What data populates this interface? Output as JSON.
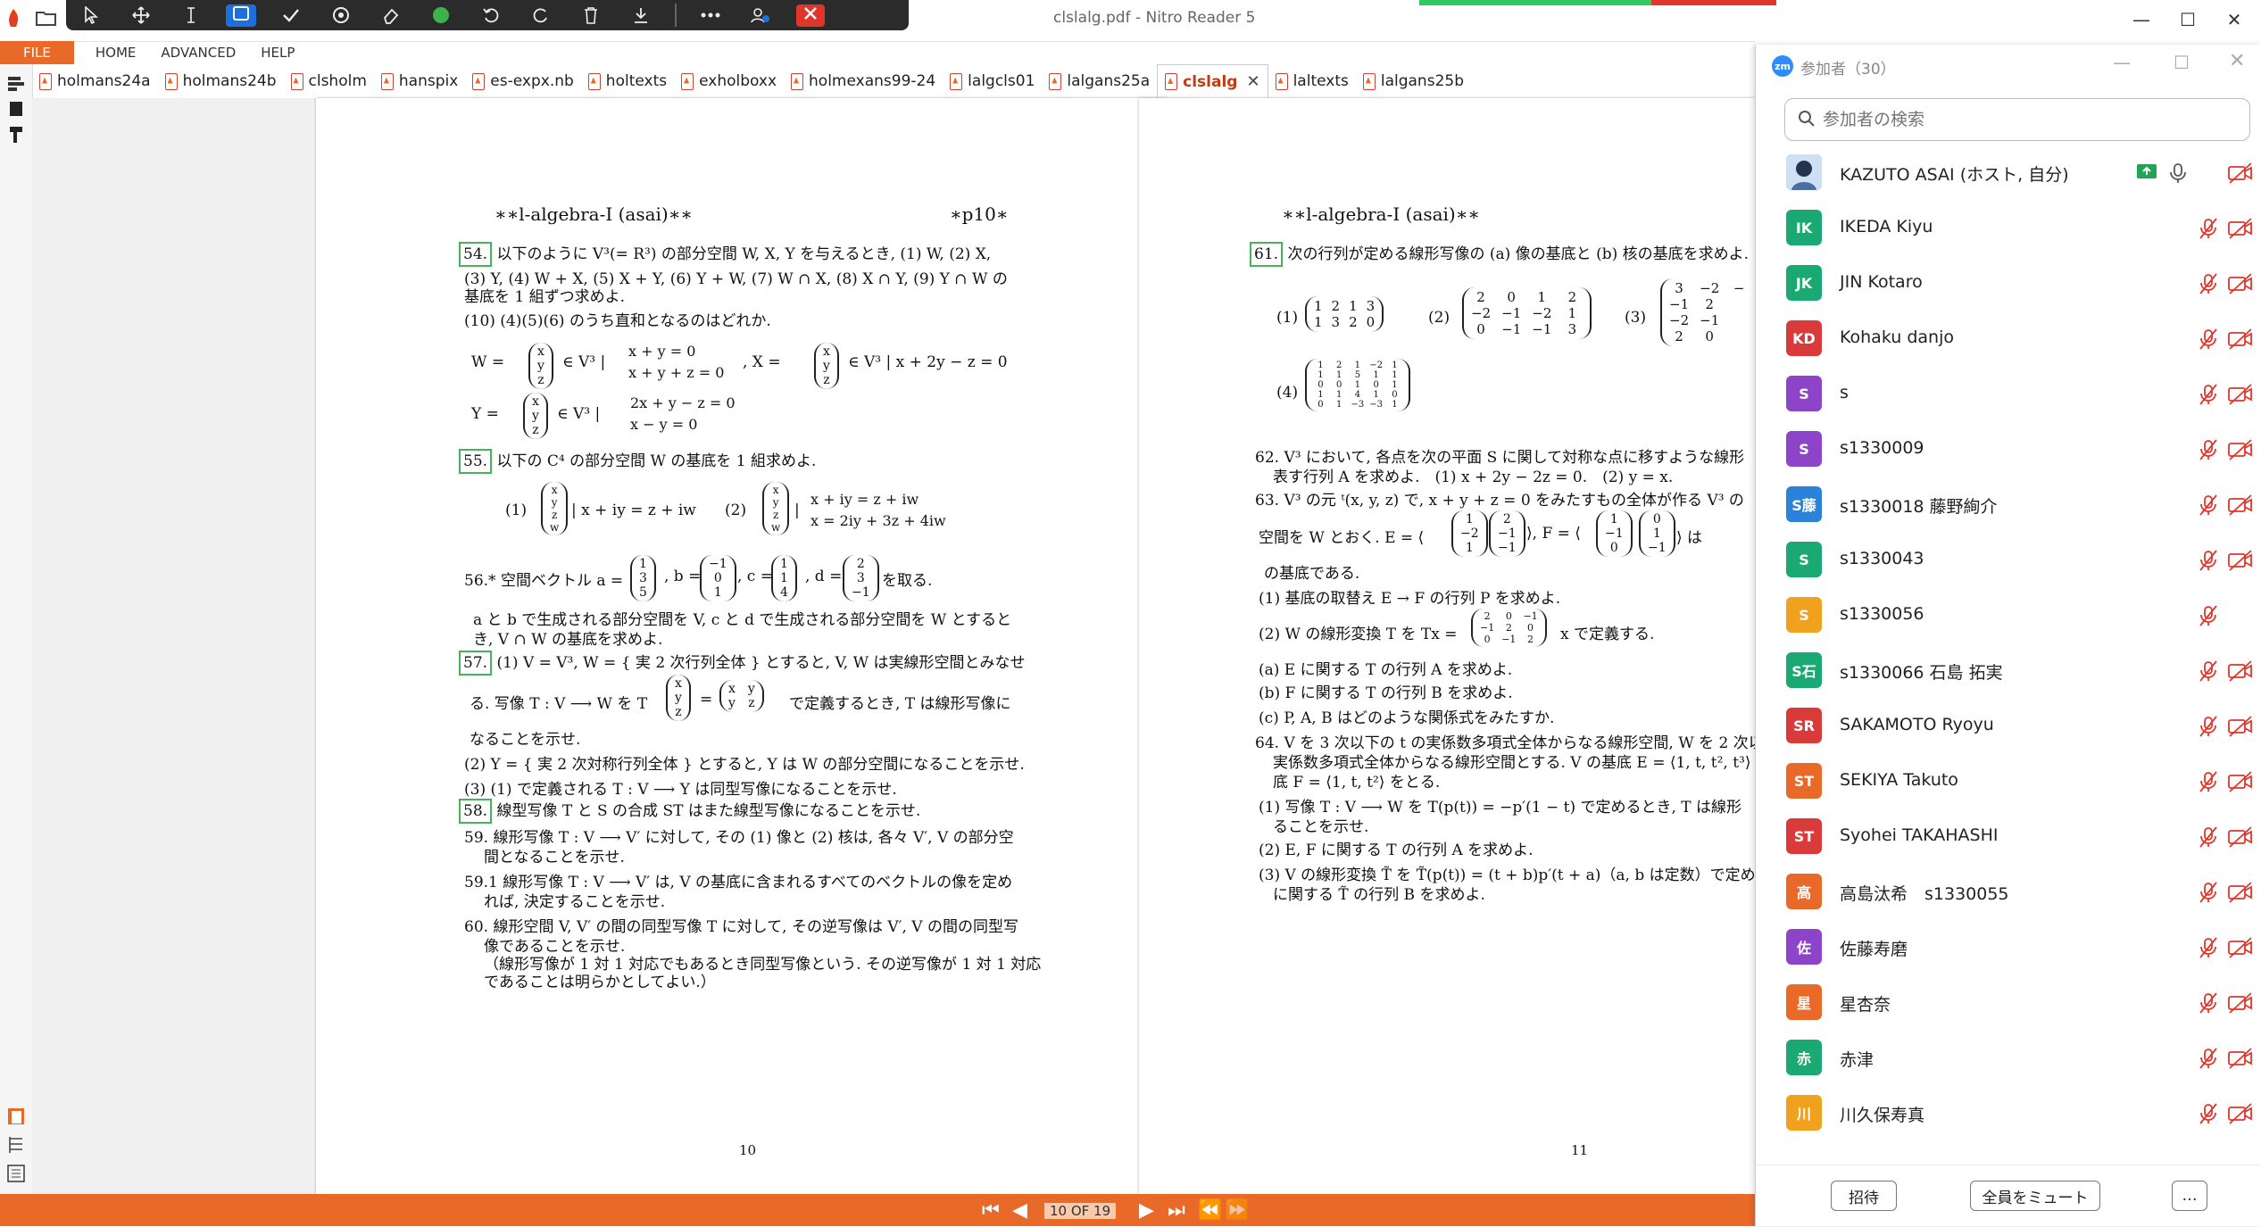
{
  "window": {
    "title": "clslalg.pdf - Nitro Reader 5",
    "minimize": "—",
    "maximize": "☐",
    "close": "✕"
  },
  "floating_toolbar": {
    "icons": [
      "cursor-icon",
      "move-icon",
      "text-cursor-icon",
      "select-box-icon",
      "check-icon",
      "target-icon",
      "eraser-icon",
      "circle-icon",
      "undo-icon",
      "redo-icon",
      "trash-icon",
      "download-icon",
      "more-icon",
      "share-icon",
      "close-icon"
    ]
  },
  "menu": {
    "file": "FILE",
    "home": "HOME",
    "advanced": "ADVANCED",
    "help": "HELP"
  },
  "tabs": [
    {
      "label": "holmans24a"
    },
    {
      "label": "holmans24b"
    },
    {
      "label": "clsholm"
    },
    {
      "label": "hanspix"
    },
    {
      "label": "es-expx.nb"
    },
    {
      "label": "holtexts"
    },
    {
      "label": "exholboxx"
    },
    {
      "label": "holmexans99-24"
    },
    {
      "label": "lalgcls01"
    },
    {
      "label": "lalgans25a"
    },
    {
      "label": "clslalg",
      "active": true
    },
    {
      "label": "laltexts"
    },
    {
      "label": "lalgans25b"
    }
  ],
  "page10": {
    "header_left": "∗∗l-algebra-I (asai)∗∗",
    "header_right": "∗p10∗",
    "q54_num": "54.",
    "q54_l1": "以下のように V³(= R³) の部分空間 W, X, Y を与えるとき, (1) W, (2) X,",
    "q54_l2": "(3) Y, (4) W + X, (5) X + Y, (6) Y + W, (7) W ∩ X, (8) X ∩ Y, (9) Y ∩ W の",
    "q54_l3": "基底を 1 組ずつ求めよ.",
    "q54_l4": "(10) (4)(5)(6) のうち直和となるのはどれか.",
    "q54_W": "W =",
    "q54_W_cond": "∈ V³ |",
    "q54_W_eq1": "x + y = 0",
    "q54_W_eq2": "x + y + z = 0",
    "q54_X": ", X =",
    "q54_X_cond": "∈ V³ | x + 2y − z = 0",
    "q54_Y": "Y =",
    "q54_Y_cond": "∈ V³ |",
    "q54_Y_eq1": "2x + y − z = 0",
    "q54_Y_eq2": "x − y = 0",
    "q55_num": "55.",
    "q55_l1": "以下の C⁴ の部分空間 W の基底を 1 組求めよ.",
    "q55_p1": "(1)",
    "q55_p1_cond": "| x + iy = z + iw",
    "q55_p2": "(2)",
    "q55_p2_eq1": "x + iy = z + iw",
    "q55_p2_eq2": "x = 2iy + 3z + 4iw",
    "q56_l1": "56.* 空間ベクトル a =",
    "q56_b": ", b =",
    "q56_c": ", c =",
    "q56_d": ", d =",
    "q56_take": "を取る.",
    "q56_l2": "a と b で生成される部分空間を V, c と d で生成される部分空間を W とすると",
    "q56_l3": "き, V ∩ W の基底を求めよ.",
    "q57_num": "57.",
    "q57_l1": "(1) V = V³, W = { 実 2 次行列全体 } とすると, V, W は実線形空間とみなせ",
    "q57_l2a": "る. 写像 T : V ⟶ W を T",
    "q57_l2b": "=",
    "q57_l2c": "で定義するとき, T は線形写像に",
    "q57_l3": "なることを示せ.",
    "q57_l4": "(2) Y = { 実 2 次対称行列全体 } とすると, Y は W の部分空間になることを示せ.",
    "q57_l5": "(3) (1) で定義される T : V ⟶ Y は同型写像になることを示せ.",
    "q58_num": "58.",
    "q58_l1": "線型写像 T と S の合成 ST はまた線型写像になることを示せ.",
    "q59_l1": "59. 線形写像 T : V ⟶ V′ に対して, その (1) 像と (2) 核は, 各々 V′, V の部分空",
    "q59_l2": "間となることを示せ.",
    "q591_l1": "59.1 線形写像 T : V ⟶ V′ は, V の基底に含まれるすべてのベクトルの像を定め",
    "q591_l2": "れば, 決定することを示せ.",
    "q60_l1": "60. 線形空間 V, V′ の間の同型写像 T に対して, その逆写像は V′, V の間の同型写",
    "q60_l2": "像であることを示せ.",
    "q60_l3": "（線形写像が 1 対 1 対応でもあるとき同型写像という. その逆写像が 1 対 1 対応",
    "q60_l4": "であることは明らかとしてよい.）",
    "page_number": "10",
    "vec_xyz": [
      "x",
      "y",
      "z"
    ],
    "vec_xyzw": [
      "x",
      "y",
      "z",
      "w"
    ],
    "vec_a": [
      "1",
      "3",
      "5"
    ],
    "vec_b": [
      "−1",
      "0",
      "1"
    ],
    "vec_c": [
      "1",
      "1",
      "4"
    ],
    "vec_d": [
      "2",
      "3",
      "−1"
    ],
    "mat_T": [
      "x",
      "y",
      "y",
      "z"
    ]
  },
  "page11": {
    "header_left": "∗∗l-algebra-I (asai)∗∗",
    "q61_num": "61.",
    "q61_l1": "次の行列が定める線形写像の (a) 像の基底と (b) 核の基底を求めよ.",
    "q61_p1": "(1)",
    "q61_p2": "(2)",
    "q61_p3": "(3)",
    "q61_p4": "(4)",
    "m1": [
      "1",
      "2",
      "1",
      "3",
      "1",
      "3",
      "2",
      "0"
    ],
    "m2": [
      "2",
      "0",
      "1",
      "2",
      "−2",
      "−1",
      "−2",
      "1",
      "0",
      "−1",
      "−1",
      "3"
    ],
    "m3": [
      "3",
      "−2",
      "−",
      "−1",
      "2",
      "",
      "−2",
      "−1",
      "",
      "2",
      "0",
      ""
    ],
    "m4": [
      "1",
      "2",
      "1",
      "−2",
      "1",
      "1",
      "1",
      "5",
      "1",
      "1",
      "0",
      "0",
      "1",
      "0",
      "1",
      "1",
      "1",
      "4",
      "1",
      "0",
      "0",
      "1",
      "−3",
      "−3",
      "1"
    ],
    "q62_l1": "62. V³ において, 各点を次の平面 S に関して対称な点に移すような線形",
    "q62_l2": "表す行列 A を求めよ.　(1) x + 2y − 2z = 0.　(2) y = x.",
    "q63_l1": "63. V³ の元 ᵗ(x, y, z) で, x + y + z = 0 をみたすもの全体が作る V³ の",
    "q63_l2a": "空間を W とおく. E = ⟨",
    "q63_l2b": "⟩, F = ⟨",
    "q63_l2c": "⟩ は",
    "q63_E1": [
      "1",
      "−2",
      "1"
    ],
    "q63_E2": [
      "2",
      "−1",
      "−1"
    ],
    "q63_F1": [
      "1",
      "−1",
      "0"
    ],
    "q63_F2": [
      "0",
      "1",
      "−1"
    ],
    "q63_l3": "の基底である.",
    "q63_l4": "(1) 基底の取替え E → F の行列 P を求めよ.",
    "q63_l5a": "(2) W の線形変換 T を Tx =",
    "q63_l5b": "x で定義する.",
    "mT": [
      "2",
      "0",
      "−1",
      "−1",
      "2",
      "0",
      "0",
      "−1",
      "2"
    ],
    "q63_l6": "(a) E に関する T の行列 A を求めよ.",
    "q63_l7": "(b) F に関する T の行列 B を求めよ.",
    "q63_l8": "(c) P, A, B はどのような関係式をみたすか.",
    "q64_l1": "64. V を 3 次以下の t の実係数多項式全体からなる線形空間, W を 2 次以",
    "q64_l2": "実係数多項式全体からなる線形空間とする. V の基底 E = ⟨1, t, t², t³⟩",
    "q64_l3": "底 F = ⟨1, t, t²⟩ をとる.",
    "q64_l4": "(1) 写像 T : V ⟶ W を T(p(t)) = −p′(1 − t) で定めるとき, T は線形",
    "q64_l5": "ることを示せ.",
    "q64_l6": "(2) E, F に関する T の行列 A を求めよ.",
    "q64_l7": "(3) V の線形変換 T̃ を T̃(p(t)) = (t + b)p′(t + a)（a, b は定数）で定め",
    "q64_l8": "に関する T̃ の行列 B を求めよ.",
    "page_number": "11"
  },
  "statusbar": {
    "page_indicator": "10 OF 19"
  },
  "zoom": {
    "logo": "zm",
    "title": "参加者（30）",
    "search_placeholder": "参加者の検索",
    "participants": [
      {
        "name": "KAZUTO ASAI (ホスト, 自分)",
        "initials": "",
        "color": "#2c6ecb",
        "host": true
      },
      {
        "name": "IKEDA Kiyu",
        "initials": "IK",
        "color": "#1aa873"
      },
      {
        "name": "JIN Kotaro",
        "initials": "JK",
        "color": "#1aa873"
      },
      {
        "name": "Kohaku danjo",
        "initials": "KD",
        "color": "#d93b3b"
      },
      {
        "name": "s",
        "initials": "S",
        "color": "#8e44c9"
      },
      {
        "name": "s1330009",
        "initials": "S",
        "color": "#8e44c9"
      },
      {
        "name": "s1330018 藤野絢介",
        "initials": "S藤",
        "color": "#2b82d9"
      },
      {
        "name": "s1330043",
        "initials": "S",
        "color": "#1aa873"
      },
      {
        "name": "s1330056",
        "initials": "S",
        "color": "#f0a11e"
      },
      {
        "name": "s1330066 石島 拓実",
        "initials": "S石",
        "color": "#1aa873"
      },
      {
        "name": "SAKAMOTO Ryoyu",
        "initials": "SR",
        "color": "#d93b3b"
      },
      {
        "name": "SEKIYA Takuto",
        "initials": "ST",
        "color": "#e96a28"
      },
      {
        "name": "Syohei TAKAHASHI",
        "initials": "ST",
        "color": "#d93b3b"
      },
      {
        "name": "高島汰希　s1330055",
        "initials": "高",
        "color": "#e96a28"
      },
      {
        "name": "佐藤寿磨",
        "initials": "佐",
        "color": "#8e44c9"
      },
      {
        "name": "星杏奈",
        "initials": "星",
        "color": "#e96a28"
      },
      {
        "name": "赤津",
        "initials": "赤",
        "color": "#1aa873"
      },
      {
        "name": "川久保寿真",
        "initials": "川",
        "color": "#f0a11e"
      }
    ],
    "invite": "招待",
    "mute_all": "全員をミュート",
    "more": "…"
  }
}
